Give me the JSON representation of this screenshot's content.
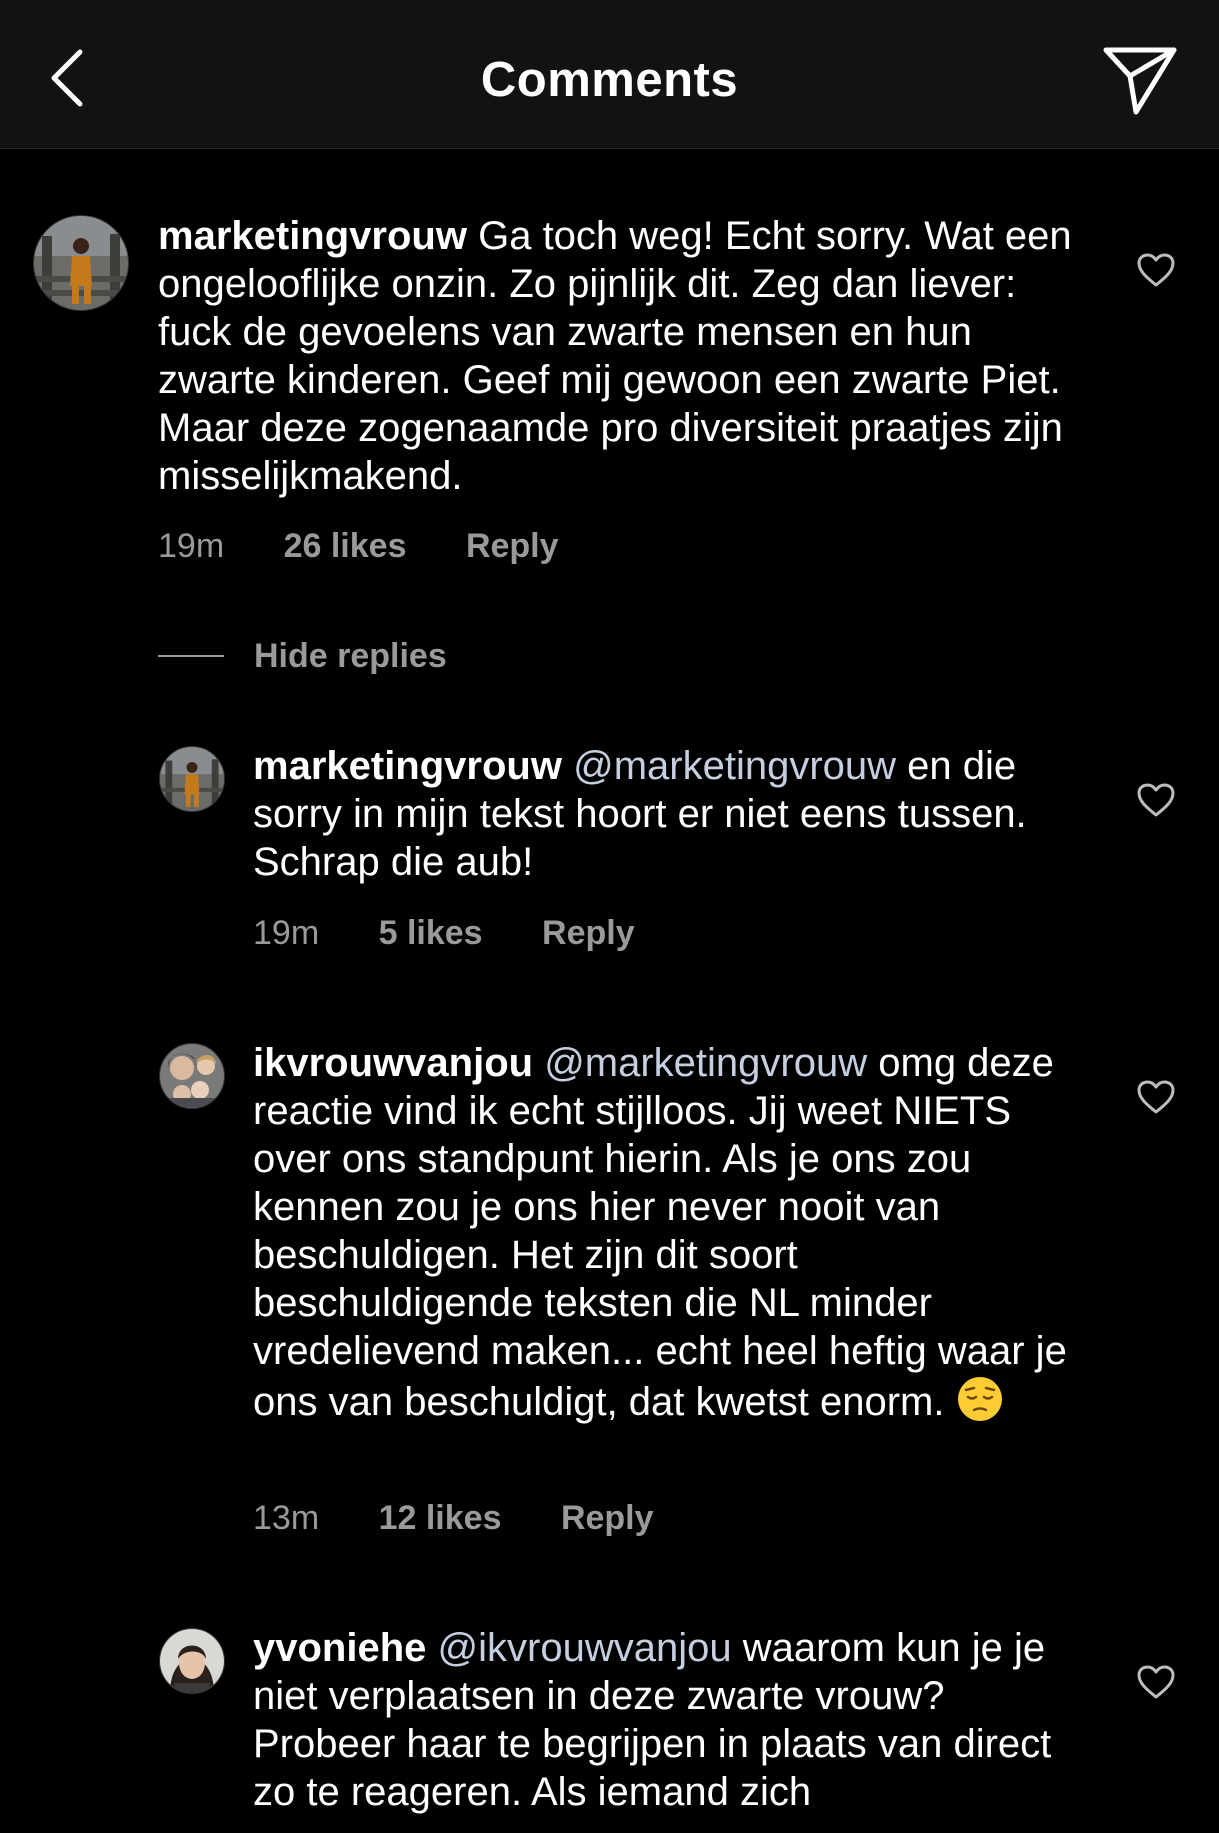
{
  "header": {
    "title": "Comments",
    "back_icon": "chevron-left-icon",
    "send_icon": "paper-plane-icon"
  },
  "colors": {
    "background": "#000000",
    "header_bg": "#121212",
    "text": "#ffffff",
    "secondary": "#9a9a9a"
  },
  "comments": [
    {
      "username": "marketingvrouw",
      "mention": "",
      "text": "Ga toch weg! Echt sorry. Wat een ongelooflijke onzin. Zo pijnlijk dit. Zeg dan liever: fuck de gevoelens van zwarte mensen en hun zwarte kinderen. Geef mij gewoon een zwarte Piet. Maar deze zogenaamde pro diversiteit praatjes zijn misselijkmakend.",
      "time": "19m",
      "likes": "26 likes",
      "reply": "Reply"
    }
  ],
  "hide_replies": "Hide replies",
  "replies": [
    {
      "username": "marketingvrouw",
      "mention": "@marketingvrouw",
      "text": "en die sorry in mijn tekst hoort er niet eens tussen. Schrap die aub!",
      "time": "19m",
      "likes": "5 likes",
      "reply": "Reply"
    },
    {
      "username": "ikvrouwvanjou",
      "mention": "@marketingvrouw",
      "text": "omg deze reactie vind ik echt stijlloos. Jij weet NIETS over ons standpunt hierin. Als je ons zou kennen zou je ons hier never nooit van beschuldigen. Het zijn dit soort beschuldigende teksten die NL minder vredelievend maken... echt heel heftig waar je ons van beschuldigt, dat kwetst enorm.",
      "emoji": "😔",
      "time": "13m",
      "likes": "12 likes",
      "reply": "Reply"
    },
    {
      "username": "yvoniehe",
      "mention": "@ikvrouwvanjou",
      "text": "waarom kun je je niet verplaatsen in deze zwarte vrouw? Probeer haar te begrijpen in plaats van direct zo te reageren. Als iemand zich"
    }
  ]
}
